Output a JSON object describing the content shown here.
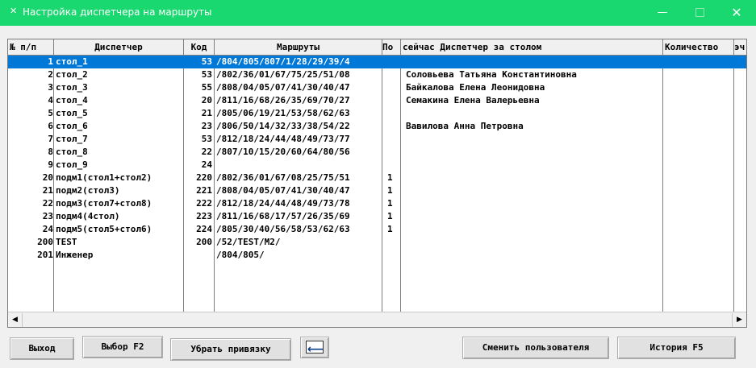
{
  "window": {
    "title": "Настройка диспетчера на маршруты",
    "minimize_glyph": "—",
    "close_glyph": "✕",
    "app_icon": "✕"
  },
  "colors": {
    "titlebar": "#19d86f",
    "selection": "#0078d7"
  },
  "grid": {
    "columns": [
      "№ п/п",
      "Диспетчер",
      "Код",
      "Маршруты",
      "По",
      "сейчас Диспетчер за столом",
      "Количество",
      "эч"
    ],
    "rows": [
      {
        "num": "1",
        "disp": "стол_1",
        "kod": "53",
        "routes": "/804/805/807/1/28/29/39/4",
        "pod": "",
        "now": ""
      },
      {
        "num": "2",
        "disp": "стол_2",
        "kod": "53",
        "routes": "/802/36/01/67/75/25/51/08",
        "pod": "",
        "now": "Соловьева Татьяна Константиновна"
      },
      {
        "num": "3",
        "disp": "стол_3",
        "kod": "55",
        "routes": "/808/04/05/07/41/30/40/47",
        "pod": "",
        "now": "Байкалова Елена Леонидовна"
      },
      {
        "num": "4",
        "disp": "стол_4",
        "kod": "20",
        "routes": "/811/16/68/26/35/69/70/27",
        "pod": "",
        "now": "Семакина Елена Валерьевна"
      },
      {
        "num": "5",
        "disp": "стол_5",
        "kod": "21",
        "routes": "/805/06/19/21/53/58/62/63",
        "pod": "",
        "now": ""
      },
      {
        "num": "6",
        "disp": "стол_6",
        "kod": "23",
        "routes": "/806/50/14/32/33/38/54/22",
        "pod": "",
        "now": "Вавилова Анна Петровна"
      },
      {
        "num": "7",
        "disp": "стол_7",
        "kod": "53",
        "routes": "/812/18/24/44/48/49/73/77",
        "pod": "",
        "now": ""
      },
      {
        "num": "8",
        "disp": "стол_8",
        "kod": "22",
        "routes": "/807/10/15/20/60/64/80/56",
        "pod": "",
        "now": ""
      },
      {
        "num": "9",
        "disp": "стол_9",
        "kod": "24",
        "routes": "",
        "pod": "",
        "now": ""
      },
      {
        "num": "20",
        "disp": "подм1(стол1+стол2)",
        "kod": "220",
        "routes": "/802/36/01/67/08/25/75/51",
        "pod": "1",
        "now": ""
      },
      {
        "num": "21",
        "disp": "подм2(стол3)",
        "kod": "221",
        "routes": "/808/04/05/07/41/30/40/47",
        "pod": "1",
        "now": ""
      },
      {
        "num": "22",
        "disp": "подм3(стол7+стол8)",
        "kod": "222",
        "routes": "/812/18/24/44/48/49/73/78",
        "pod": "1",
        "now": ""
      },
      {
        "num": "23",
        "disp": "подм4(4стол)",
        "kod": "223",
        "routes": "/811/16/68/17/57/26/35/69",
        "pod": "1",
        "now": ""
      },
      {
        "num": "24",
        "disp": "подм5(стол5+стол6)",
        "kod": "224",
        "routes": "/805/30/40/56/58/53/62/63",
        "pod": "1",
        "now": ""
      },
      {
        "num": "200",
        "disp": "TEST",
        "kod": "200",
        "routes": "/52/TEST/M2/",
        "pod": "",
        "now": ""
      },
      {
        "num": "201",
        "disp": "Инженер",
        "kod": "",
        "routes": "/804/805/",
        "pod": "",
        "now": ""
      }
    ]
  },
  "buttons": {
    "exit": "Выход",
    "choose": "Выбор F2",
    "unlink": "Убрать привязку",
    "change_user": "Сменить пользователя",
    "history": "История F5"
  },
  "scrollbar": {
    "left_arrow": "◀",
    "right_arrow": "▶"
  }
}
